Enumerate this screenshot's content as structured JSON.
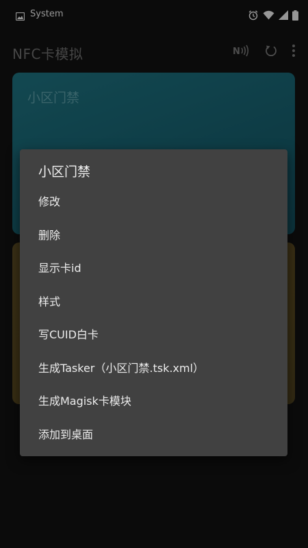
{
  "status_bar": {
    "label": "System"
  },
  "app_bar": {
    "title": "NFC卡模拟"
  },
  "cards": [
    {
      "title": "小区门禁",
      "color": "#176170"
    },
    {
      "title": "",
      "color": "#564720"
    }
  ],
  "menu": {
    "title": "小区门禁",
    "items": [
      {
        "label": "修改"
      },
      {
        "label": "删除"
      },
      {
        "label": "显示卡id"
      },
      {
        "label": "样式"
      },
      {
        "label": "写CUID白卡"
      },
      {
        "label": "生成Tasker（小区门禁.tsk.xml）"
      },
      {
        "label": "生成Magisk卡模块"
      },
      {
        "label": "添加到桌面"
      }
    ]
  },
  "colors": {
    "background": "#111111",
    "menu_background": "#414141"
  },
  "icons": {
    "status_left": "image-icon",
    "status_right": [
      "alarm-icon",
      "wifi-icon",
      "signal-icon",
      "battery-icon"
    ],
    "actions": [
      "nfc-icon",
      "refresh-icon",
      "more-vert-icon"
    ]
  }
}
